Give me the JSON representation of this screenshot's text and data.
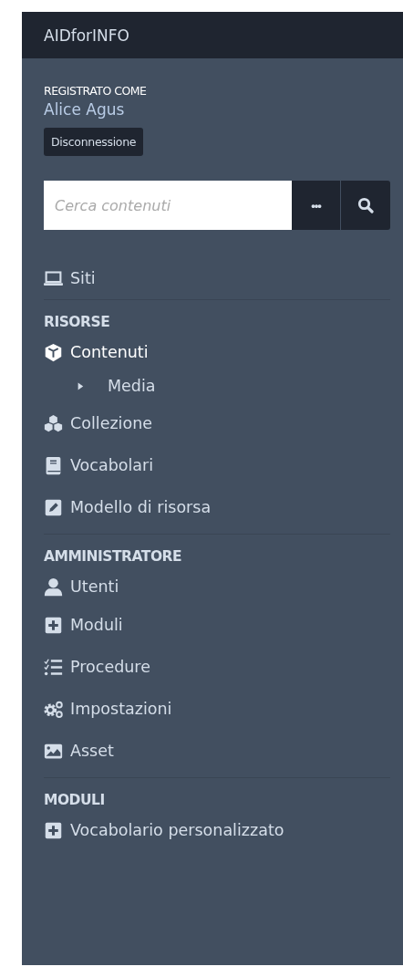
{
  "brand": "AIDforINFO",
  "user": {
    "label": "REGISTRATO COME",
    "name": "Alice Agus"
  },
  "logout_button": "Disconnessione",
  "search": {
    "placeholder": "Cerca contenuti",
    "options_button": "•••"
  },
  "sections": [
    {
      "items": [
        {
          "label": "Siti",
          "kind": "laptop",
          "selected": false
        }
      ]
    },
    {
      "heading": "RISORSE",
      "items": [
        {
          "label": "Contenuti",
          "kind": "cube",
          "selected": true,
          "children": [
            {
              "label": "Media",
              "expanded": false,
              "selected": false
            }
          ]
        },
        {
          "label": "Collezione",
          "kind": "cubes",
          "selected": false
        },
        {
          "label": "Vocabolari",
          "kind": "book",
          "selected": false
        },
        {
          "label": "Modello di risorsa",
          "kind": "edit",
          "selected": false
        }
      ]
    },
    {
      "heading": "AMMINISTRATORE",
      "items": [
        {
          "label": "Utenti",
          "kind": "user",
          "selected": false
        },
        {
          "label": "Moduli",
          "kind": "plus",
          "selected": false
        },
        {
          "label": "Procedure",
          "kind": "tasks",
          "selected": false
        },
        {
          "label": "Impostazioni",
          "kind": "cogs",
          "selected": false
        },
        {
          "label": "Asset",
          "kind": "image",
          "selected": false
        }
      ]
    },
    {
      "heading": "MODULI",
      "items": [
        {
          "label": "Vocabolario personalizzato",
          "kind": "plus",
          "selected": false
        }
      ]
    }
  ]
}
